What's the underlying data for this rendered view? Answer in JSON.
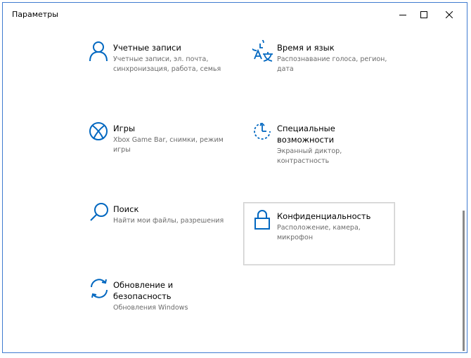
{
  "window": {
    "title": "Параметры"
  },
  "colors": {
    "accent": "#0067c0",
    "border": "#3f7bd0",
    "desc_text": "#6b6b6b"
  },
  "tiles": [
    {
      "name": "Учетные записи",
      "desc": "Учетные записи, эл. почта, синхронизация, работа, семья",
      "icon": "person-icon"
    },
    {
      "name": "Время и язык",
      "desc": "Распознавание голоса, регион, дата",
      "icon": "time-language-icon"
    },
    {
      "name": "Игры",
      "desc": "Xbox Game Bar, снимки, режим игры",
      "icon": "xbox-icon"
    },
    {
      "name": "Специальные возможности",
      "desc": "Экранный диктор, контрастность",
      "icon": "ease-of-access-icon"
    },
    {
      "name": "Поиск",
      "desc": "Найти мои файлы, разрешения",
      "icon": "search-icon"
    },
    {
      "name": "Конфиденциальность",
      "desc": "Расположение, камера, микрофон",
      "icon": "lock-icon"
    },
    {
      "name": "Обновление и безопасность",
      "desc": "Обновления Windows",
      "icon": "sync-icon"
    }
  ]
}
